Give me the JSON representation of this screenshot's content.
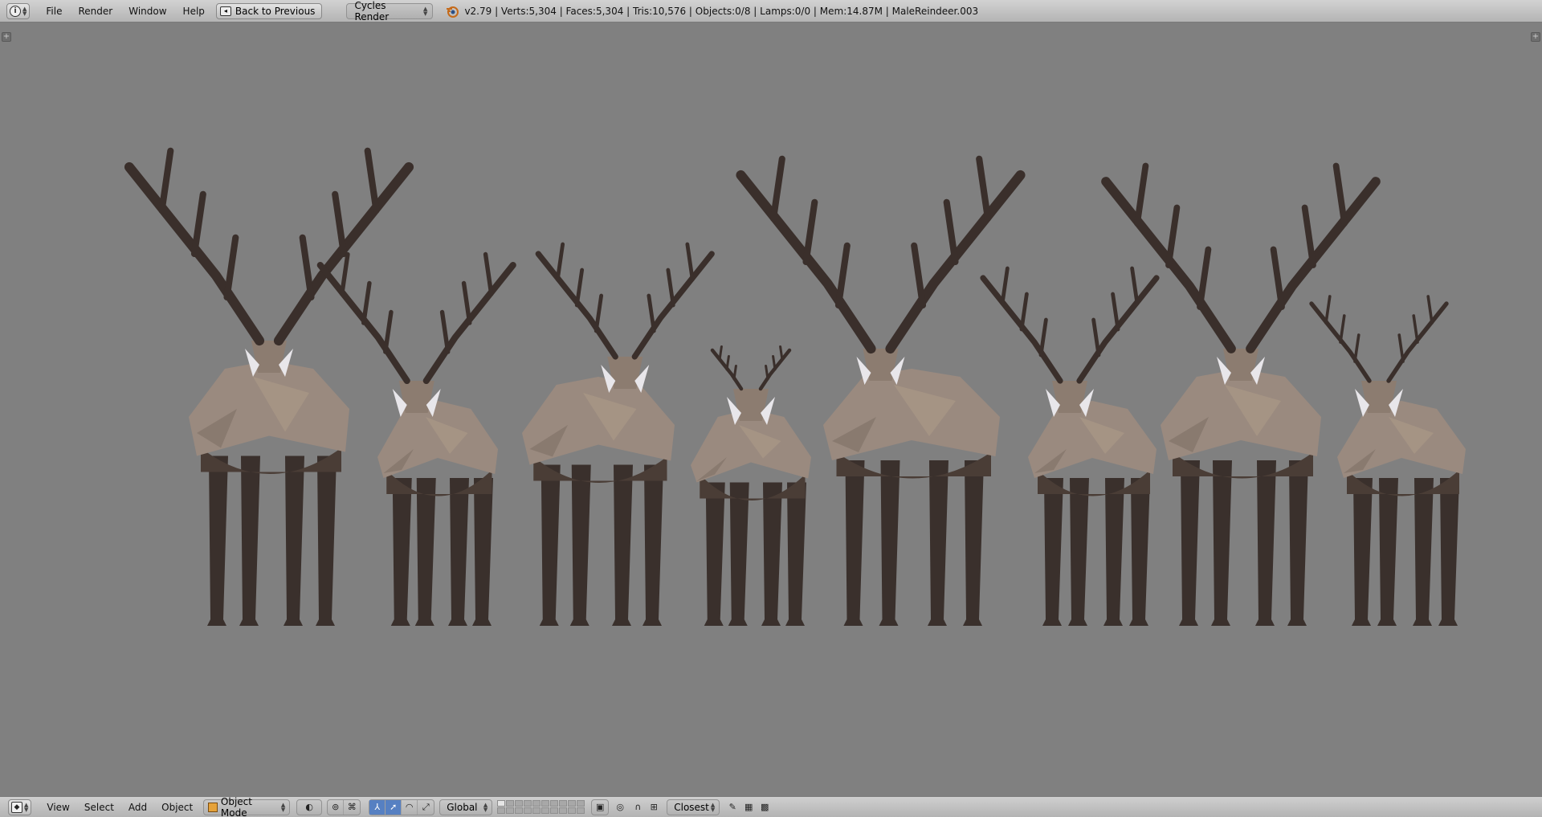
{
  "header": {
    "editor_icon": "info-icon",
    "menus": [
      "File",
      "Render",
      "Window",
      "Help"
    ],
    "back_button": "Back to Previous",
    "render_engine": "Cycles Render",
    "logo_icon": "blender-logo-icon",
    "stats": "v2.79 | Verts:5,304 | Faces:5,304 | Tris:10,576 | Objects:0/8 | Lamps:0/0 | Mem:14.87M | MaleReindeer.003"
  },
  "viewport": {
    "background": "#808080",
    "corner_left": "+",
    "corner_right": "+",
    "reindeer_count": 8,
    "colors": {
      "antler": "#3a2f2b",
      "body": "#9a8a7f",
      "legs": "#3a302c",
      "white": "#e8e6ea"
    }
  },
  "footer": {
    "editor_icon": "3d-view-icon",
    "menus": [
      "View",
      "Select",
      "Add",
      "Object"
    ],
    "mode": "Object Mode",
    "viewport_shading_icon": "solid-shading-icon",
    "pivot_icon": "pivot-point-icon",
    "manipulator_icons": [
      "manipulator-toggle-icon",
      "translate-icon",
      "rotate-icon",
      "scale-icon"
    ],
    "orientation": "Global",
    "snap_target": "Closest",
    "accent": "#5680c2"
  }
}
